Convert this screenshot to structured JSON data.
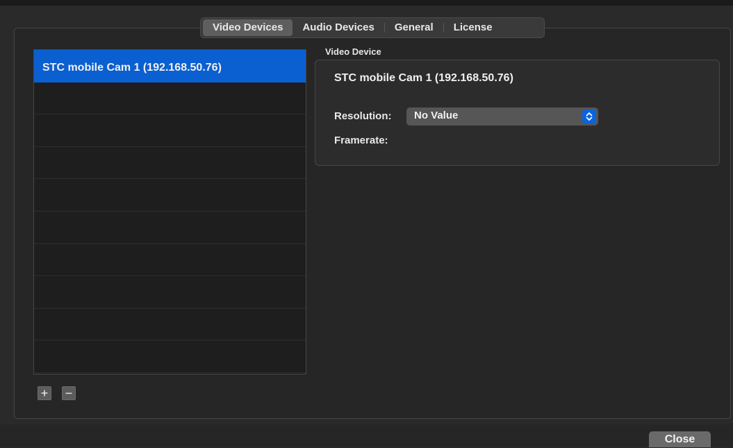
{
  "tabs": [
    {
      "label": "Video Devices",
      "active": true
    },
    {
      "label": "Audio Devices",
      "active": false
    },
    {
      "label": "General",
      "active": false
    },
    {
      "label": "License",
      "active": false
    }
  ],
  "device_list": {
    "items": [
      {
        "label": "STC mobile Cam 1 (192.168.50.76)",
        "selected": true
      }
    ],
    "empty_rows": 9,
    "add_label": "+",
    "remove_label": "−"
  },
  "video_device": {
    "section_label": "Video Device",
    "name": "STC mobile Cam 1 (192.168.50.76)",
    "resolution_label": "Resolution:",
    "resolution_value": "No Value",
    "framerate_label": "Framerate:"
  },
  "footer": {
    "close_label": "Close"
  },
  "colors": {
    "accent": "#0a5fd1",
    "background": "#2a2a2a"
  }
}
